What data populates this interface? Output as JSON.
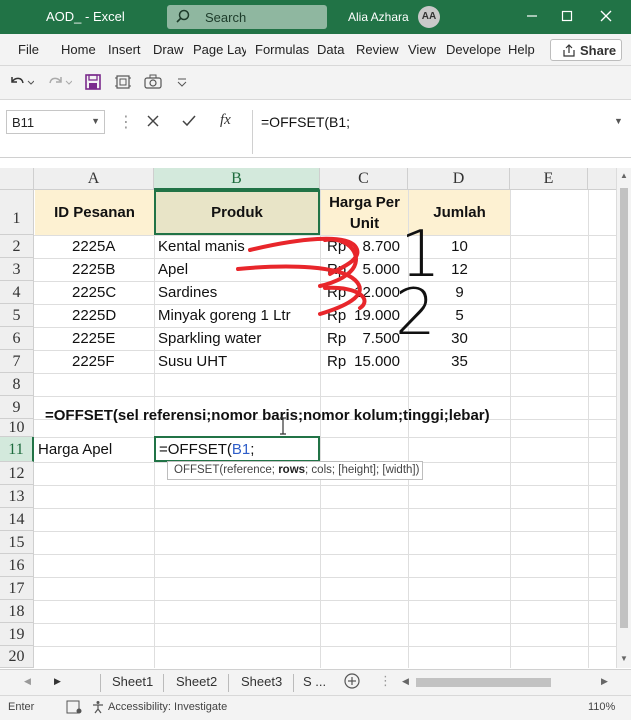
{
  "titlebar": {
    "title": "AOD_ - Excel",
    "search_label": "Search",
    "user_name": "Alia Azhara",
    "avatar_initials": "AA",
    "accent": "#217346"
  },
  "menu": {
    "items": [
      "File",
      "Home",
      "Insert",
      "Draw",
      "Page Layout",
      "Formulas",
      "Data",
      "Review",
      "View",
      "Developer",
      "Help"
    ],
    "share_label": "Share"
  },
  "formula_bar": {
    "name_box": "B11",
    "fx_label": "fx",
    "formula": "=OFFSET(B1;"
  },
  "grid": {
    "columns": [
      "A",
      "B",
      "C",
      "D",
      "E"
    ],
    "rows": [
      "1",
      "2",
      "3",
      "4",
      "5",
      "6",
      "7",
      "8",
      "9",
      "10",
      "11",
      "12",
      "13",
      "14",
      "15",
      "16",
      "17",
      "18",
      "19",
      "20"
    ],
    "headers": {
      "id": "ID Pesanan",
      "product": "Produk",
      "price": "Harga Per Unit",
      "qty": "Jumlah"
    },
    "data_rows": [
      {
        "id": "2225A",
        "product": "Kental manis",
        "currency": "Rp",
        "price": "8.700",
        "qty": "10"
      },
      {
        "id": "2225B",
        "product": "Apel",
        "currency": "Rp",
        "price": "5.000",
        "qty": "12"
      },
      {
        "id": "2225C",
        "product": "Sardines",
        "currency": "Rp",
        "price": "12.000",
        "qty": "9"
      },
      {
        "id": "2225D",
        "product": "Minyak goreng 1 Ltr",
        "currency": "Rp",
        "price": "19.000",
        "qty": "5"
      },
      {
        "id": "2225E",
        "product": "Sparkling water",
        "currency": "Rp",
        "price": "7.500",
        "qty": "30"
      },
      {
        "id": "2225F",
        "product": "Susu UHT",
        "currency": "Rp",
        "price": "15.000",
        "qty": "35"
      }
    ],
    "note": "=OFFSET(sel referensi;nomor baris;nomor kolum;tinggi;lebar)",
    "a11": "Harga Apel",
    "active_cell_prefix": "=OFFSET(",
    "active_cell_ref": "B1",
    "active_cell_suffix": ";",
    "tooltip": {
      "fn": "OFFSET(",
      "arg1": "reference; ",
      "arg2_bold": "rows",
      "rest": "; cols; [height]; [width])"
    },
    "annotations": {
      "one": "1",
      "two": "2",
      "ink_color": "#e8262b"
    }
  },
  "sheets": {
    "tabs": [
      "Sheet1",
      "Sheet2",
      "Sheet3",
      "S ..."
    ]
  },
  "status": {
    "mode": "Enter",
    "accessibility": "Accessibility: Investigate",
    "zoom": "110%"
  }
}
